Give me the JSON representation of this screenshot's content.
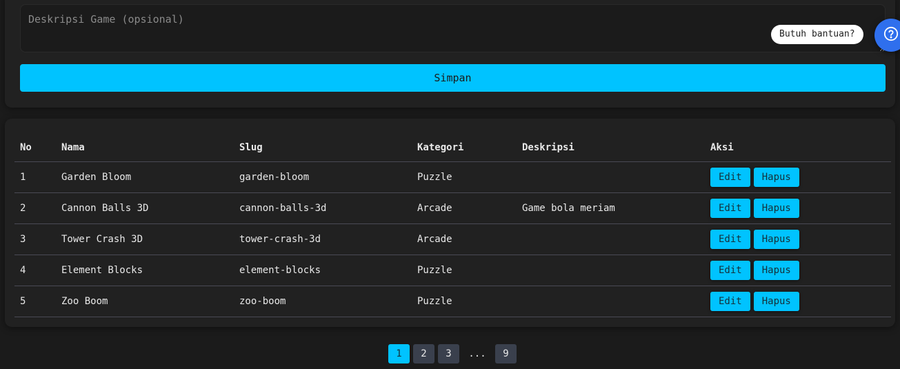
{
  "form": {
    "description_placeholder": "Deskripsi Game (opsional)",
    "description_value": "",
    "save_label": "Simpan"
  },
  "help": {
    "label": "Butuh bantuan?",
    "icon": "question-circle-icon"
  },
  "table": {
    "headers": [
      "No",
      "Nama",
      "Slug",
      "Kategori",
      "Deskripsi",
      "Aksi"
    ],
    "rows": [
      {
        "no": "1",
        "name": "Garden Bloom",
        "slug": "garden-bloom",
        "category": "Puzzle",
        "description": ""
      },
      {
        "no": "2",
        "name": "Cannon Balls 3D",
        "slug": "cannon-balls-3d",
        "category": "Arcade",
        "description": "Game bola meriam"
      },
      {
        "no": "3",
        "name": "Tower Crash 3D",
        "slug": "tower-crash-3d",
        "category": "Arcade",
        "description": ""
      },
      {
        "no": "4",
        "name": "Element Blocks",
        "slug": "element-blocks",
        "category": "Puzzle",
        "description": ""
      },
      {
        "no": "5",
        "name": "Zoo Boom",
        "slug": "zoo-boom",
        "category": "Puzzle",
        "description": ""
      }
    ],
    "edit_label": "Edit",
    "delete_label": "Hapus"
  },
  "pagination": {
    "pages": [
      "1",
      "2",
      "3"
    ],
    "ellipsis": "...",
    "last": "9",
    "current": "1"
  },
  "colors": {
    "accent": "#00c3ff",
    "help_button": "#2f6fed",
    "background": "#1b1b1b",
    "card": "#212121"
  }
}
